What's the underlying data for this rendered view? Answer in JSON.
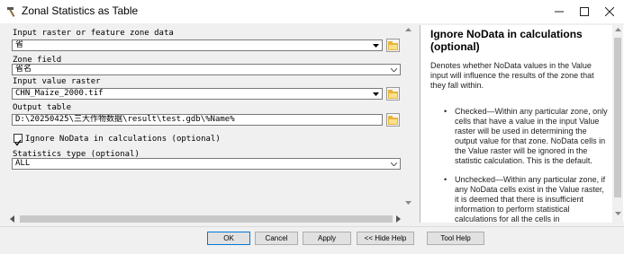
{
  "window": {
    "title": "Zonal Statistics as Table",
    "title_icon": "hammer-icon",
    "buttons": [
      "minimize-icon",
      "maximize-icon",
      "close-icon"
    ]
  },
  "form": {
    "input_zone": {
      "label": "Input raster or feature zone data",
      "value": "省"
    },
    "zone_field": {
      "label": "Zone field",
      "value": "省名"
    },
    "value_raster": {
      "label": "Input value raster",
      "value": "CHN_Maize_2000.tif"
    },
    "output_table": {
      "label": "Output table",
      "value": "D:\\20250425\\三大作物数据\\result\\test.gdb\\%Name%"
    },
    "ignore_nodata": {
      "label": "Ignore NoData in calculations (optional)",
      "checked": true
    },
    "statistics_type": {
      "label": "Statistics type (optional)",
      "value": "ALL"
    }
  },
  "help": {
    "title": "Ignore NoData in calculations (optional)",
    "intro": "Denotes whether NoData values in the Value input will influence the results of the zone that they fall within.",
    "bullets": [
      "Checked—Within any particular zone, only cells that have a value in the input Value raster will be used in determining the output value for that zone. NoData cells in the Value raster will be ignored in the statistic calculation. This is the default.",
      "Unchecked—Within any particular zone, if any NoData cells exist in the Value raster, it is deemed that there is insufficient information to perform statistical calculations for all the cells in"
    ]
  },
  "buttons": {
    "ok": "OK",
    "cancel": "Cancel",
    "apply": "Apply",
    "hide_help": "<< Hide Help",
    "tool_help": "Tool Help"
  },
  "colors": {
    "accent": "#0078d7",
    "folder": "#e8b33a"
  }
}
